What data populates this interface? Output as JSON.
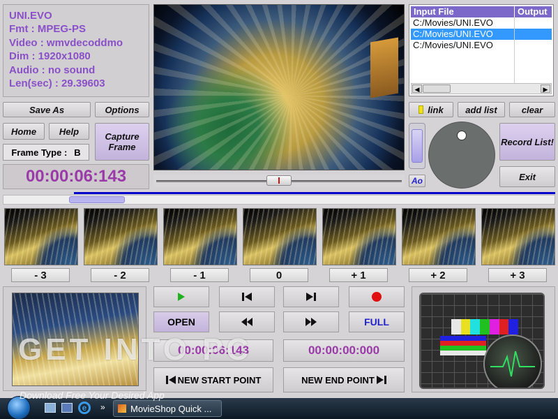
{
  "file_info": {
    "name": "UNI.EVO",
    "format": "Fmt : MPEG-PS",
    "video": "Video : wmvdecoddmo",
    "dim": "Dim : 1920x1080",
    "audio": "Audio : no sound",
    "length": "Len(sec) : 29.39603"
  },
  "buttons": {
    "save_as": "Save As",
    "options": "Options",
    "home": "Home",
    "help": "Help",
    "capture_frame": "Capture Frame",
    "link": "link",
    "add_list": "add list",
    "clear": "clear",
    "record_list": "Record List!",
    "exit": "Exit",
    "ao": "Ao",
    "open": "OPEN",
    "full": "FULL",
    "new_start_point": "NEW START POINT",
    "new_end_point": "NEW END POINT"
  },
  "frame_type": {
    "label": "Frame Type :",
    "value": "B"
  },
  "current_time": "00:00:06:143",
  "list": {
    "headers": [
      "Input File",
      "Output"
    ],
    "rows": [
      "C:/Movies/UNI.EVO",
      "C:/Movies/UNI.EVO",
      "C:/Movies/UNI.EVO"
    ],
    "selected_index": 1
  },
  "frame_offsets": [
    "- 3",
    "- 2",
    "- 1",
    "0",
    "+ 1",
    "+ 2",
    "+ 3"
  ],
  "start_point": "00:00:06:143",
  "end_point": "00:00:00:000",
  "taskbar": {
    "window_title": "MovieShop Quick ..."
  },
  "watermark": {
    "title": "GET INTO PC",
    "subtitle": "Download Free Your Desired App"
  },
  "colors": {
    "accent_purple": "#8a50c8",
    "timer_purple": "#9a3aa8",
    "selection_blue": "#3399ff",
    "header_bar": "#7b68c8",
    "record_red": "#e01010",
    "play_green": "#20b020"
  }
}
